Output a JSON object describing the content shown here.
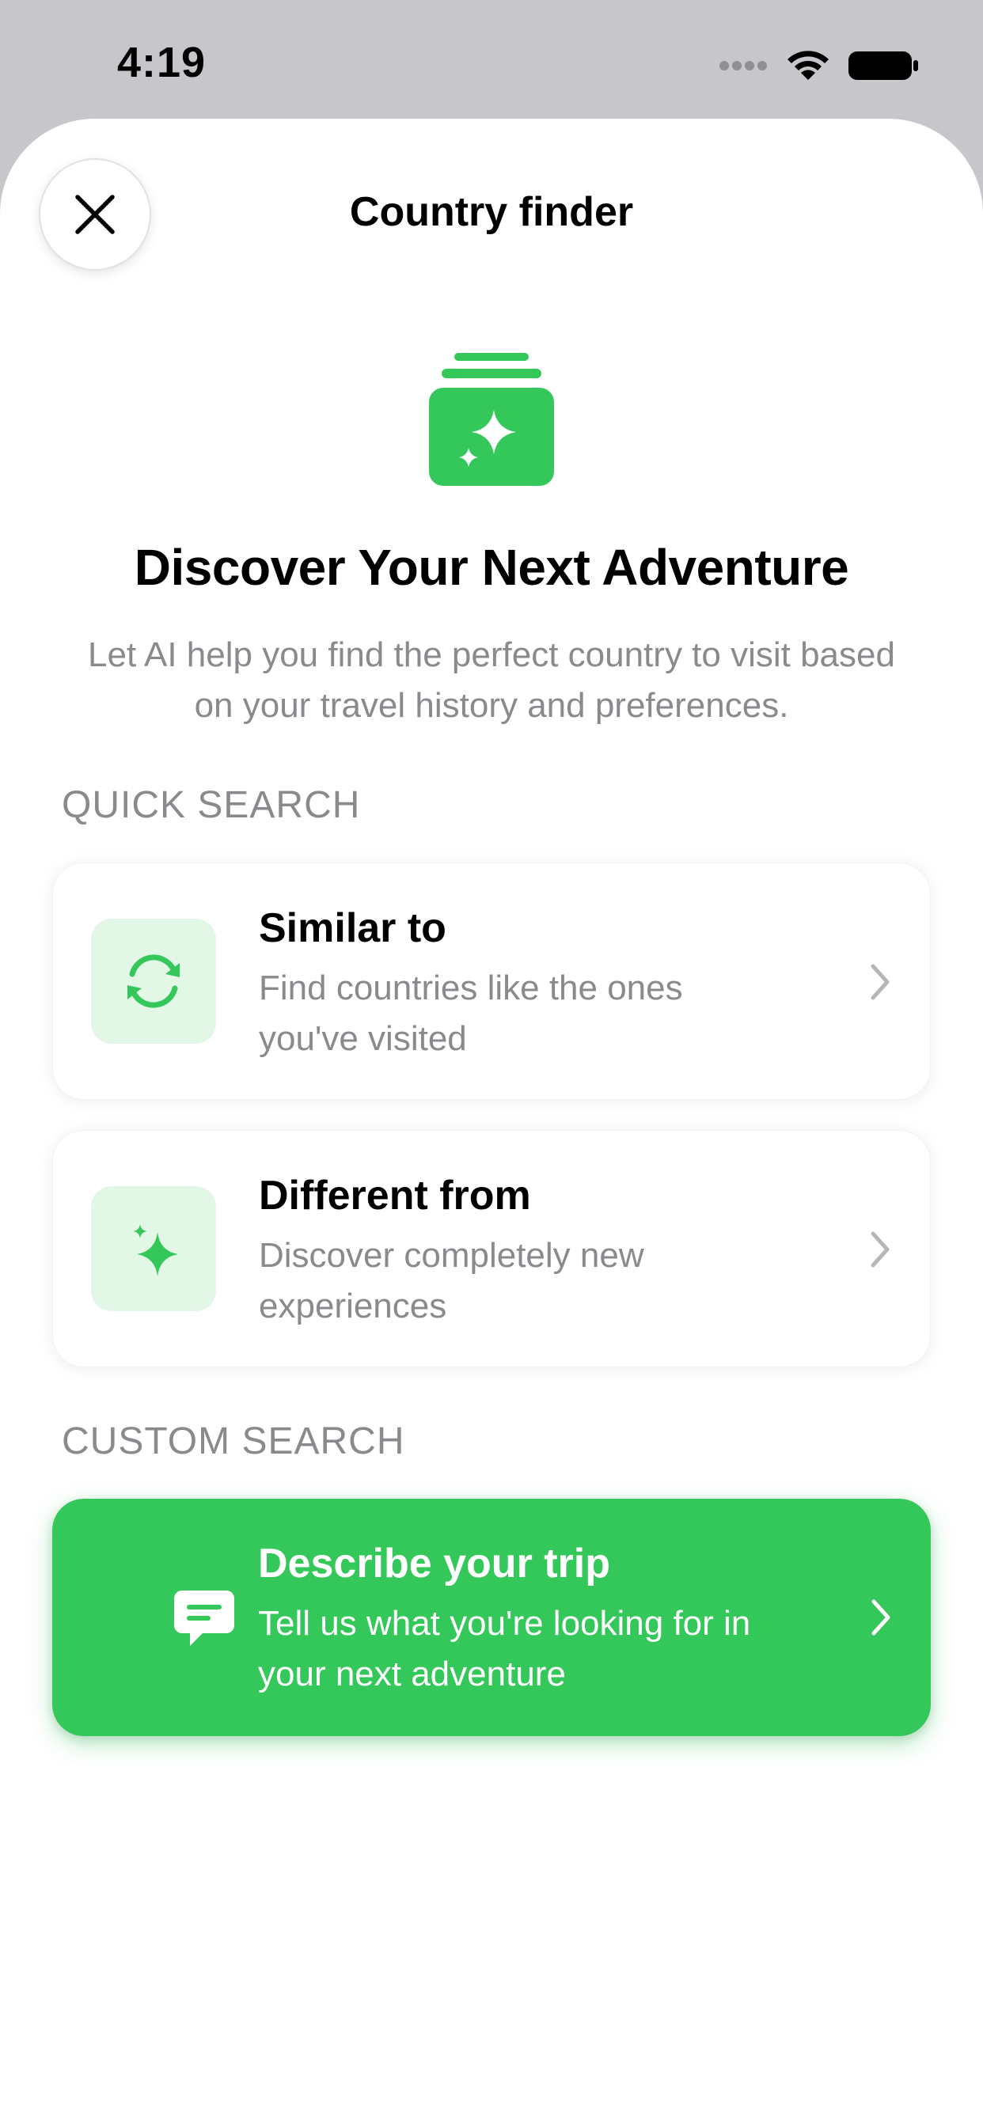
{
  "status_bar": {
    "time": "4:19"
  },
  "header": {
    "title": "Country finder"
  },
  "hero": {
    "title": "Discover Your Next Adventure",
    "subtitle": "Let AI help you find the perfect country to visit based on your travel history and preferences."
  },
  "quick_search": {
    "label": "QUICK SEARCH",
    "items": [
      {
        "title": "Similar to",
        "description": "Find countries like the ones you've visited",
        "icon": "refresh-icon"
      },
      {
        "title": "Different from",
        "description": "Discover completely new experiences",
        "icon": "sparkles-icon"
      }
    ]
  },
  "custom_search": {
    "label": "CUSTOM SEARCH",
    "item": {
      "title": "Describe your trip",
      "description": "Tell us what you're looking for in your next adventure",
      "icon": "chat-bubble-icon"
    }
  },
  "colors": {
    "accent": "#34c759",
    "accent_light": "#e3f7e7",
    "secondary_text": "#8a8a8e",
    "backdrop": "#c6c6cb"
  }
}
